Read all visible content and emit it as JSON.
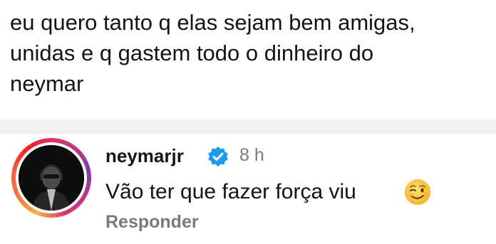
{
  "tweet": {
    "text": "eu quero tanto q elas sejam bem amigas,\nunidas e q gastem todo o dinheiro do\nneymar"
  },
  "comment": {
    "username": "neymarjr",
    "time": "8 h",
    "text": "Vão ter que fazer força viu",
    "emoji": "winking-face-emoji",
    "reply_label": "Responder"
  }
}
